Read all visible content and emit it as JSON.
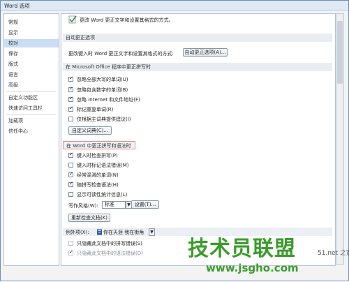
{
  "window": {
    "title": "Word 选项"
  },
  "nav": {
    "items": [
      "常规",
      "显示",
      "校对",
      "保存",
      "版式",
      "语言",
      "高级",
      "自定义功能区",
      "快速访问工具栏",
      "加载项",
      "信任中心"
    ],
    "selected_index": 2
  },
  "top": {
    "desc": "更改 Word 更正文字和设置其格式的方式。"
  },
  "autocorrect": {
    "header": "自动更正选项",
    "desc": "更改键入时 Word 更正文字和设置其格式的方式:",
    "button": "自动更正选项(A)..."
  },
  "office": {
    "header": "在 Microsoft Office 程序中更正拼写时",
    "opt1": "忽略全部大写的单词(U)",
    "opt2": "忽略包含数字的单词(B)",
    "opt3": "忽略 Internet 和文件地址(F)",
    "opt4": "标记重复单词(R)",
    "opt5": "仅根据主词典提供建议(I)",
    "custom_button": "自定义词典(C)..."
  },
  "word": {
    "header": "在 Word 中更正拼写和语法时",
    "opt1": "键入时检查拼写(P)",
    "opt2": "键入时标记语法错误(M)",
    "opt3": "经常混淆的单词(N)",
    "opt4": "随拼写检查语法(H)",
    "opt5": "显示可读性统计信息(L)",
    "style_label": "写作风格(W):",
    "style_value": "标准",
    "settings_button": "设置(T)...",
    "recheck_button": "重新检查文档(K)"
  },
  "exceptions": {
    "label": "例外项(X):",
    "doc": "你在天涯 我在街角",
    "opt1": "只隐藏此文档中的拼写错误(S)",
    "opt2": "只隐藏此文档中的语法错误(D)"
  },
  "watermark": {
    "logo": "技术员联盟",
    "site": "www.jsgho.com",
    "small": "51.net 之家"
  }
}
